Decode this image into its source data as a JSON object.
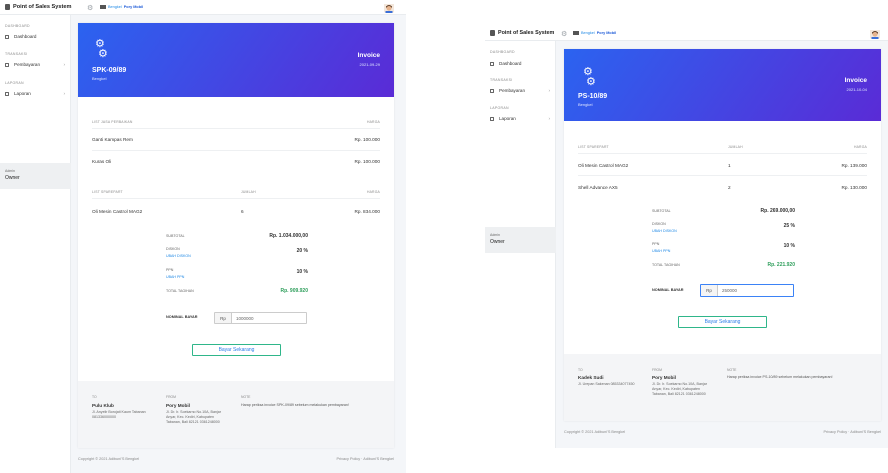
{
  "app": {
    "title": "Point of Sales System"
  },
  "crumb": {
    "prefix": "Bengkel",
    "name": "Pory Mobil"
  },
  "sidebar": {
    "heading_dashboard": "DASHBOARD",
    "dashboard": "Dashboard",
    "heading_transaksi": "TRANSAKSI",
    "pembayaran": "Pembayaran",
    "heading_laporan": "LAPORAN",
    "laporan": "Laporan",
    "user_role": "Admin",
    "user_name": "Owner"
  },
  "headers": {
    "jasa": "LIST JASA PERBAIKAN",
    "harga": "HARGA",
    "sparepart": "LIST SPAREPART",
    "jumlah": "JUMLAH",
    "subtotal": "SUBTOTAL",
    "diskon": "DISKON",
    "ubah_diskon": "UBAH DISKON",
    "ppn": "PPN",
    "ubah_ppn": "UBAH PPN",
    "total": "TOTAL TAGIHAN",
    "nominal": "NOMINAL BAYAR",
    "to": "TO",
    "from": "FROM",
    "note": "NOTE"
  },
  "invoiceA": {
    "label": "Invoice",
    "code": "SPK-09/89",
    "location": "Bengkel",
    "date": "2021-09-29",
    "services": [
      {
        "name": "Ganti Kampas Rem",
        "price": "Rp. 100.000"
      },
      {
        "name": "Kuras Oli",
        "price": "Rp. 100.000"
      }
    ],
    "spareparts": [
      {
        "name": "Oli Mesin Castrol MAG2",
        "qty": "6",
        "price": "Rp. 834.000"
      }
    ],
    "subtotal": "Rp. 1.034.000,00",
    "diskon": "20 %",
    "ppn": "10 %",
    "total": "Rp. 909.920",
    "currency": "Rp",
    "nominal": "1000000",
    "pay_button": "Bayar Sekarang",
    "to_name": "Pulu Klub",
    "to_addr": "Jl. Anyelir Borojati Kaum Tabanan 081336000000",
    "from_name": "Pory Mobil",
    "from_addr": "Jl. Dr. Ir. Soekarno No.10A, Banjar Anyar, Kec. Kediri, Kabupaten Tabanan, Bali 82121 0361248000",
    "note": "Harap periksa invoice SPK-09/89 sebelum melakukan pembayaran!"
  },
  "invoiceB": {
    "label": "Invoice",
    "code": "PS-10/89",
    "location": "Bengkel",
    "date": "2021-10-04",
    "spareparts": [
      {
        "name": "Oli Mesin Castrol MAG2",
        "qty": "1",
        "price": "Rp. 139.000"
      },
      {
        "name": "Shell Advance AX5",
        "qty": "2",
        "price": "Rp. 130.000"
      }
    ],
    "subtotal": "Rp. 269.000,00",
    "diskon": "25 %",
    "ppn": "10 %",
    "total": "Rp. 221.920",
    "currency": "Rp",
    "nominal": "250000",
    "pay_button": "Bayar Sekarang",
    "to_name": "Kadek Sudi",
    "to_addr": "Jl. Urepan Sakenan 085334077450",
    "from_name": "Pory Mobil",
    "from_addr": "Jl. Dr. Ir. Soekarno No.10A, Banjar Anyar, Kec. Kediri, Kabupaten Tabanan, Bali 82121 0361248000",
    "note": "Harap periksa invoice PS-10/89 sebelum melakukan pembayaran!"
  },
  "page_footer": {
    "copyright": "Copyright © 2021 Adibuni'S Bengkel",
    "links": "Privacy Policy · Adibuni'S Bengkel"
  },
  "colors": {
    "banner_start": "#2b63f0",
    "banner_end": "#5a2bd6",
    "total_green": "#2e9e5b",
    "link_blue": "#1e88e5",
    "button_border": "#2fb68a"
  }
}
